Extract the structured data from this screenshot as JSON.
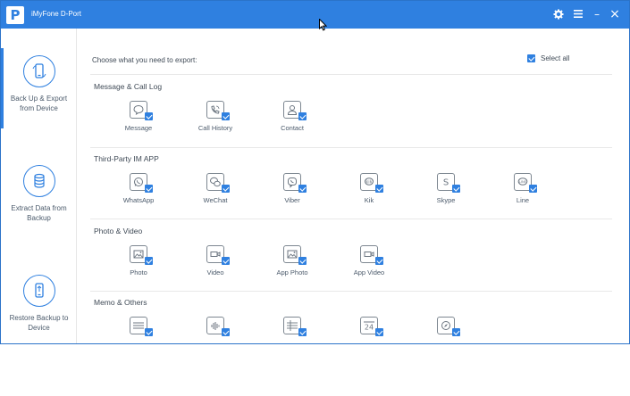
{
  "app": {
    "logo_letter": "P",
    "title": "iMyFone D-Port"
  },
  "window_controls": {
    "settings_icon": "gear-icon",
    "menu_icon": "menu-icon",
    "minimize": "–",
    "close": "×"
  },
  "sidebar": {
    "items": [
      {
        "label": "Back Up & Export from Device",
        "icon": "phone-sync-icon",
        "active": true
      },
      {
        "label": "Extract Data from Backup",
        "icon": "database-icon",
        "active": false
      },
      {
        "label": "Restore Backup to Device",
        "icon": "phone-restore-icon",
        "active": false
      }
    ]
  },
  "main": {
    "prompt": "Choose what you need to export:",
    "select_all_label": "Select all",
    "select_all_checked": true,
    "sections": [
      {
        "title": "Message & Call Log",
        "items": [
          {
            "label": "Message",
            "icon": "message-icon",
            "checked": true
          },
          {
            "label": "Call History",
            "icon": "call-history-icon",
            "checked": true
          },
          {
            "label": "Contact",
            "icon": "contact-icon",
            "checked": true
          }
        ]
      },
      {
        "title": "Third-Party IM APP",
        "items": [
          {
            "label": "WhatsApp",
            "icon": "whatsapp-icon",
            "checked": true
          },
          {
            "label": "WeChat",
            "icon": "wechat-icon",
            "checked": true
          },
          {
            "label": "Viber",
            "icon": "viber-icon",
            "checked": true
          },
          {
            "label": "Kik",
            "icon": "kik-icon",
            "checked": true
          },
          {
            "label": "Skype",
            "icon": "skype-icon",
            "checked": true
          },
          {
            "label": "Line",
            "icon": "line-icon",
            "checked": true
          }
        ]
      },
      {
        "title": "Photo & Video",
        "items": [
          {
            "label": "Photo",
            "icon": "photo-icon",
            "checked": true
          },
          {
            "label": "Video",
            "icon": "video-icon",
            "checked": true
          },
          {
            "label": "App Photo",
            "icon": "app-photo-icon",
            "checked": true
          },
          {
            "label": "App Video",
            "icon": "app-video-icon",
            "checked": true
          }
        ]
      },
      {
        "title": "Memo & Others",
        "items": [
          {
            "label": "",
            "icon": "notes-icon",
            "checked": true
          },
          {
            "label": "",
            "icon": "voice-memo-icon",
            "checked": true
          },
          {
            "label": "",
            "icon": "table-icon",
            "checked": true
          },
          {
            "label": "",
            "icon": "calendar-icon",
            "checked": true
          },
          {
            "label": "",
            "icon": "safari-icon",
            "checked": true
          }
        ]
      }
    ]
  },
  "colors": {
    "accent": "#2f80e0",
    "text": "#3f4a56",
    "divider": "#e8e8e8"
  }
}
